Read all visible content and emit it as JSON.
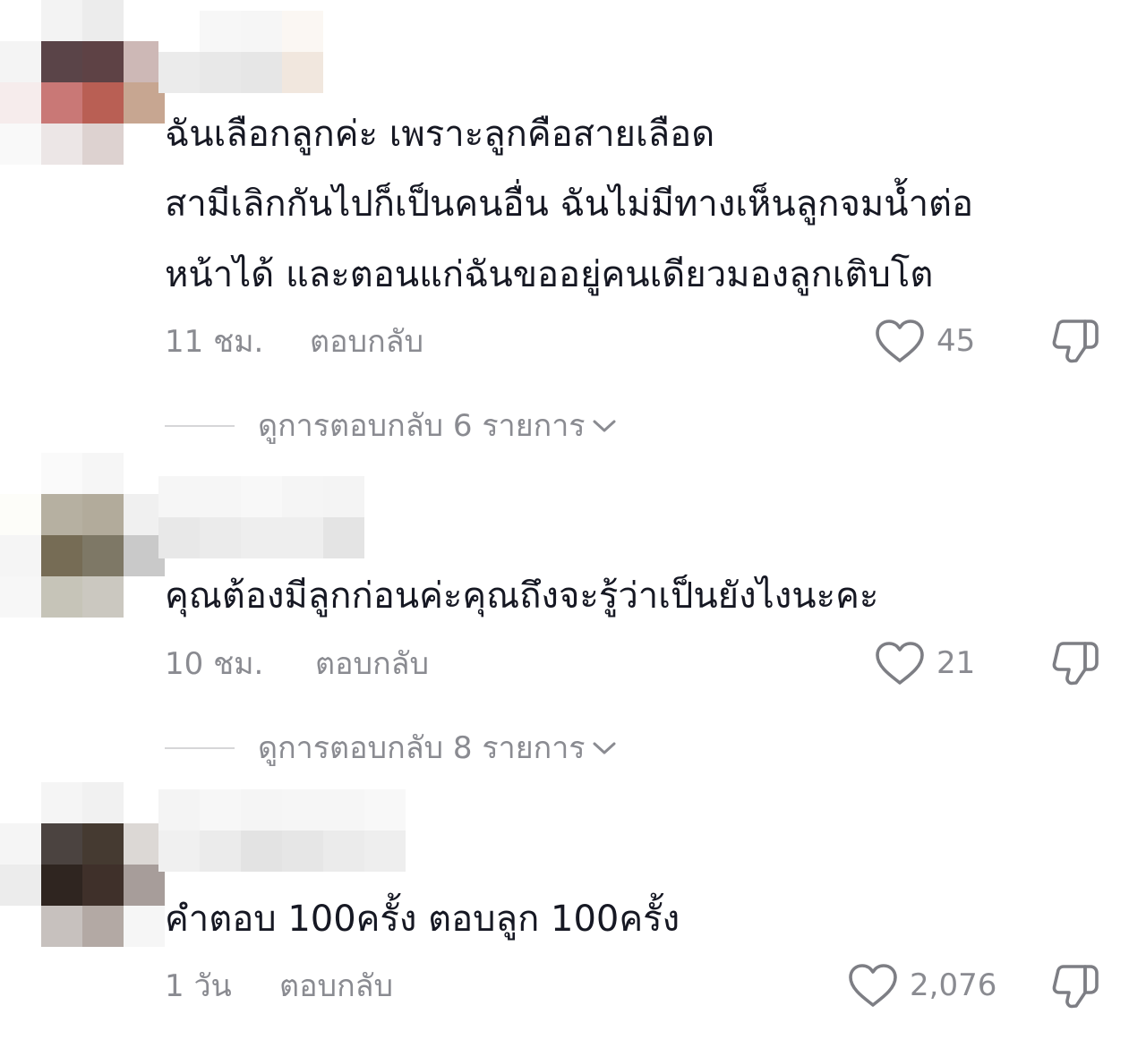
{
  "comments": [
    {
      "text_lines": [
        "ฉันเลือกลูกค่ะ เพราะลูกคือสายเลือด",
        "สามีเลิกกันไปก็เป็นคนอื่น ฉันไม่มีทางเห็นลูกจมน้ำต่อ",
        "หน้าได้ และตอนแก่ฉันขออยู่คนเดียวมองลูกเติบโต"
      ],
      "time": "11 ชม.",
      "reply_label": "ตอบกลับ",
      "like_count": "45",
      "view_replies_label": "ดูการตอบกลับ 6 รายการ",
      "avatar_icon": "pixelated-avatar",
      "avatar_colors": [
        "#ffffff",
        "#f3f3f3",
        "#ececec",
        "#ffffff",
        "#f4f4f4",
        "#5a4448",
        "#5e4245",
        "#cdb8b6",
        "#f6ecec",
        "#c97876",
        "#b95f54",
        "#c7a691",
        "#f9f9f9",
        "#ece6e6",
        "#ddd2d0",
        "#ffffff"
      ],
      "username_colors": [
        "#ffffff",
        "#ebebeb",
        "#f7f7f7",
        "#e8e8e8",
        "#f6f6f6",
        "#e6e6e6",
        "#fbf7f3",
        "#f1e7de"
      ]
    },
    {
      "text_lines": [
        "คุณต้องมีลูกก่อนค่ะคุณถึงจะรู้ว่าเป็นยังไงนะคะ"
      ],
      "time": "10 ชม.",
      "reply_label": "ตอบกลับ",
      "like_count": "21",
      "view_replies_label": "ดูการตอบกลับ 8 รายการ",
      "avatar_icon": "pixelated-avatar",
      "avatar_colors": [
        "#ffffff",
        "#fafafa",
        "#f6f6f6",
        "#ffffff",
        "#fdfdf9",
        "#b6b0a1",
        "#b2ab9b",
        "#f0f0f0",
        "#f5f5f5",
        "#766c55",
        "#7e7866",
        "#c9c9c9",
        "#f7f7f7",
        "#c6c4b8",
        "#cbc8c0",
        "#ffffff"
      ],
      "username_colors": [
        "#f6f6f6",
        "#e8e8e8",
        "#f6f6f6",
        "#ebebeb",
        "#f8f8f8",
        "#eeeeee",
        "#f5f5f5",
        "#eeeeee",
        "#f4f4f4",
        "#e4e4e4"
      ]
    },
    {
      "text_lines": [
        "คำตอบ 100ครั้ง ตอบลูก 100ครั้ง"
      ],
      "time": "1 วัน",
      "reply_label": "ตอบกลับ",
      "like_count": "2,076",
      "avatar_icon": "pixelated-avatar",
      "avatar_colors": [
        "#ffffff",
        "#f5f5f5",
        "#f1f1f1",
        "#ffffff",
        "#f5f5f5",
        "#4b4340",
        "#453a31",
        "#dcd8d5",
        "#ececec",
        "#2f2520",
        "#3f302a",
        "#a79d9a",
        "#ffffff",
        "#c7c1be",
        "#b3a9a4",
        "#f6f6f6"
      ],
      "username_colors": [
        "#f4f4f4",
        "#f0f0f0",
        "#f7f7f7",
        "#ebebeb",
        "#f5f5f5",
        "#e3e3e3",
        "#f6f6f6",
        "#e6e6e6",
        "#f6f6f6",
        "#ebebeb",
        "#f8f8f8",
        "#eeeeee"
      ]
    }
  ],
  "icons": {
    "like": "heart-outline-icon",
    "dislike": "thumbs-down-outline-icon",
    "expand": "chevron-down-icon"
  },
  "colors": {
    "text": "#161823",
    "secondary": "#8a8b91",
    "icon": "#7d7e84",
    "divider": "#d6d6d8"
  }
}
